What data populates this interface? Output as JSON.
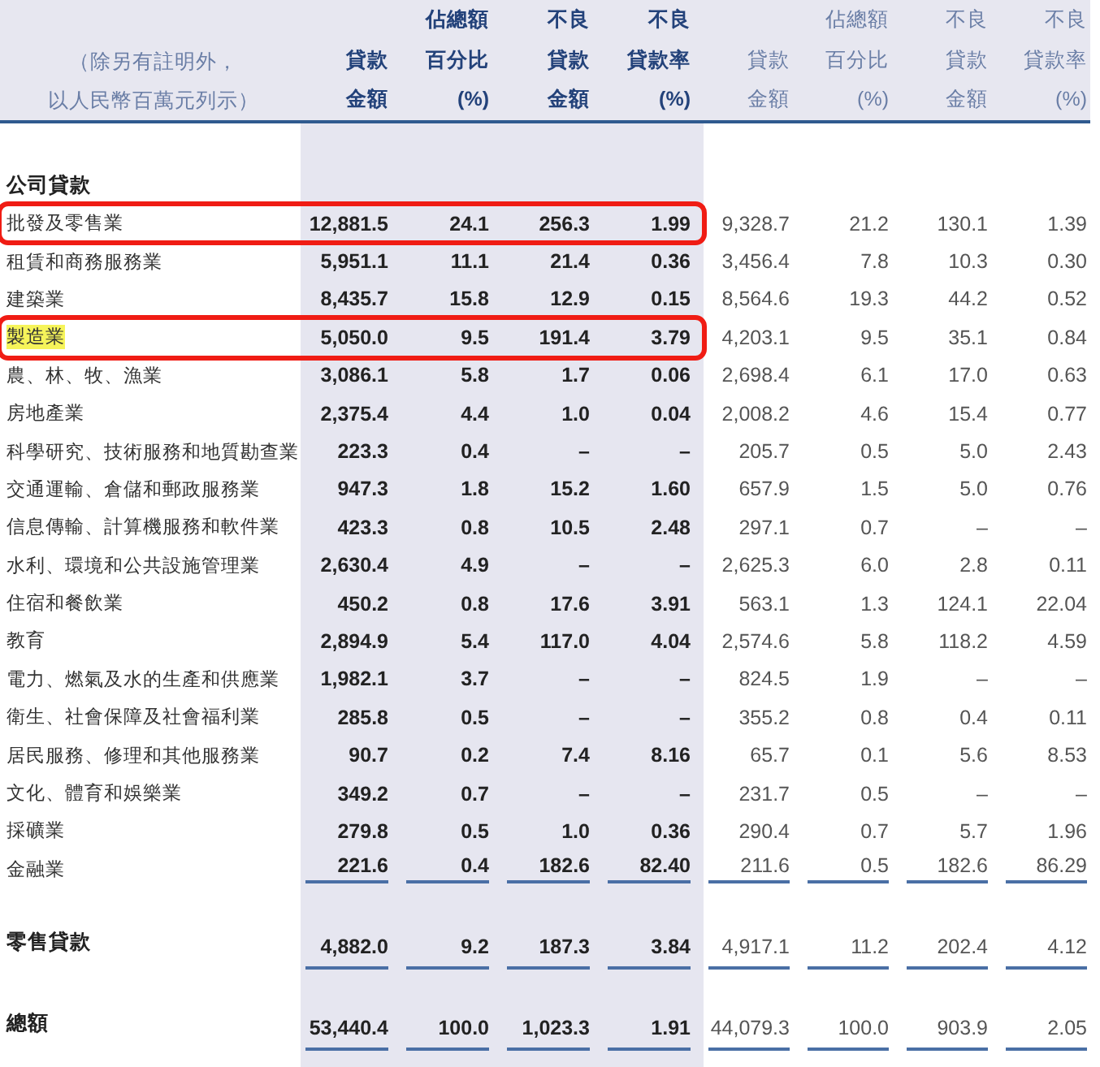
{
  "header": {
    "note": [
      "（除另有註明外，",
      "以人民幣百萬元列示）"
    ],
    "current_columns": [
      [
        "貸款",
        "金額"
      ],
      [
        "佔總額",
        "百分比",
        "(%)"
      ],
      [
        "不良",
        "貸款",
        "金額"
      ],
      [
        "不良",
        "貸款率",
        "(%)"
      ]
    ],
    "prior_columns": [
      [
        "貸款",
        "金額"
      ],
      [
        "佔總額",
        "百分比",
        "(%)"
      ],
      [
        "不良",
        "貸款",
        "金額"
      ],
      [
        "不良",
        "貸款率",
        "(%)"
      ]
    ]
  },
  "corporate": {
    "title": "公司貸款",
    "rows": [
      {
        "label": "批發及零售業",
        "current": [
          "12,881.5",
          "24.1",
          "256.3",
          "1.99"
        ],
        "prior": [
          "9,328.7",
          "21.2",
          "130.1",
          "1.39"
        ],
        "boxed": true,
        "highlighted": false
      },
      {
        "label": "租賃和商務服務業",
        "current": [
          "5,951.1",
          "11.1",
          "21.4",
          "0.36"
        ],
        "prior": [
          "3,456.4",
          "7.8",
          "10.3",
          "0.30"
        ],
        "boxed": false,
        "highlighted": false
      },
      {
        "label": "建築業",
        "current": [
          "8,435.7",
          "15.8",
          "12.9",
          "0.15"
        ],
        "prior": [
          "8,564.6",
          "19.3",
          "44.2",
          "0.52"
        ],
        "boxed": false,
        "highlighted": false
      },
      {
        "label": "製造業",
        "current": [
          "5,050.0",
          "9.5",
          "191.4",
          "3.79"
        ],
        "prior": [
          "4,203.1",
          "9.5",
          "35.1",
          "0.84"
        ],
        "boxed": true,
        "highlighted": true
      },
      {
        "label": "農、林、牧、漁業",
        "current": [
          "3,086.1",
          "5.8",
          "1.7",
          "0.06"
        ],
        "prior": [
          "2,698.4",
          "6.1",
          "17.0",
          "0.63"
        ],
        "boxed": false,
        "highlighted": false
      },
      {
        "label": "房地產業",
        "current": [
          "2,375.4",
          "4.4",
          "1.0",
          "0.04"
        ],
        "prior": [
          "2,008.2",
          "4.6",
          "15.4",
          "0.77"
        ],
        "boxed": false,
        "highlighted": false
      },
      {
        "label": "科學研究、技術服務和地質勘查業",
        "current": [
          "223.3",
          "0.4",
          "–",
          "–"
        ],
        "prior": [
          "205.7",
          "0.5",
          "5.0",
          "2.43"
        ],
        "boxed": false,
        "highlighted": false
      },
      {
        "label": "交通運輸、倉儲和郵政服務業",
        "current": [
          "947.3",
          "1.8",
          "15.2",
          "1.60"
        ],
        "prior": [
          "657.9",
          "1.5",
          "5.0",
          "0.76"
        ],
        "boxed": false,
        "highlighted": false
      },
      {
        "label": "信息傳輸、計算機服務和軟件業",
        "current": [
          "423.3",
          "0.8",
          "10.5",
          "2.48"
        ],
        "prior": [
          "297.1",
          "0.7",
          "–",
          "–"
        ],
        "boxed": false,
        "highlighted": false
      },
      {
        "label": "水利、環境和公共設施管理業",
        "current": [
          "2,630.4",
          "4.9",
          "–",
          "–"
        ],
        "prior": [
          "2,625.3",
          "6.0",
          "2.8",
          "0.11"
        ],
        "boxed": false,
        "highlighted": false
      },
      {
        "label": "住宿和餐飲業",
        "current": [
          "450.2",
          "0.8",
          "17.6",
          "3.91"
        ],
        "prior": [
          "563.1",
          "1.3",
          "124.1",
          "22.04"
        ],
        "boxed": false,
        "highlighted": false
      },
      {
        "label": "教育",
        "current": [
          "2,894.9",
          "5.4",
          "117.0",
          "4.04"
        ],
        "prior": [
          "2,574.6",
          "5.8",
          "118.2",
          "4.59"
        ],
        "boxed": false,
        "highlighted": false
      },
      {
        "label": "電力、燃氣及水的生產和供應業",
        "current": [
          "1,982.1",
          "3.7",
          "–",
          "–"
        ],
        "prior": [
          "824.5",
          "1.9",
          "–",
          "–"
        ],
        "boxed": false,
        "highlighted": false
      },
      {
        "label": "衛生、社會保障及社會福利業",
        "current": [
          "285.8",
          "0.5",
          "–",
          "–"
        ],
        "prior": [
          "355.2",
          "0.8",
          "0.4",
          "0.11"
        ],
        "boxed": false,
        "highlighted": false
      },
      {
        "label": "居民服務、修理和其他服務業",
        "current": [
          "90.7",
          "0.2",
          "7.4",
          "8.16"
        ],
        "prior": [
          "65.7",
          "0.1",
          "5.6",
          "8.53"
        ],
        "boxed": false,
        "highlighted": false
      },
      {
        "label": "文化、體育和娛樂業",
        "current": [
          "349.2",
          "0.7",
          "–",
          "–"
        ],
        "prior": [
          "231.7",
          "0.5",
          "–",
          "–"
        ],
        "boxed": false,
        "highlighted": false
      },
      {
        "label": "採礦業",
        "current": [
          "279.8",
          "0.5",
          "1.0",
          "0.36"
        ],
        "prior": [
          "290.4",
          "0.7",
          "5.7",
          "1.96"
        ],
        "boxed": false,
        "highlighted": false
      },
      {
        "label": "金融業",
        "current": [
          "221.6",
          "0.4",
          "182.6",
          "82.40"
        ],
        "prior": [
          "211.6",
          "0.5",
          "182.6",
          "86.29"
        ],
        "boxed": false,
        "highlighted": false
      }
    ]
  },
  "totals": [
    {
      "label": "零售貸款",
      "current": [
        "4,882.0",
        "9.2",
        "187.3",
        "3.84"
      ],
      "prior": [
        "4,917.1",
        "11.2",
        "202.4",
        "4.12"
      ]
    },
    {
      "label": "總額",
      "current": [
        "53,440.4",
        "100.0",
        "1,023.3",
        "1.91"
      ],
      "prior": [
        "44,079.3",
        "100.0",
        "903.9",
        "2.05"
      ]
    }
  ]
}
